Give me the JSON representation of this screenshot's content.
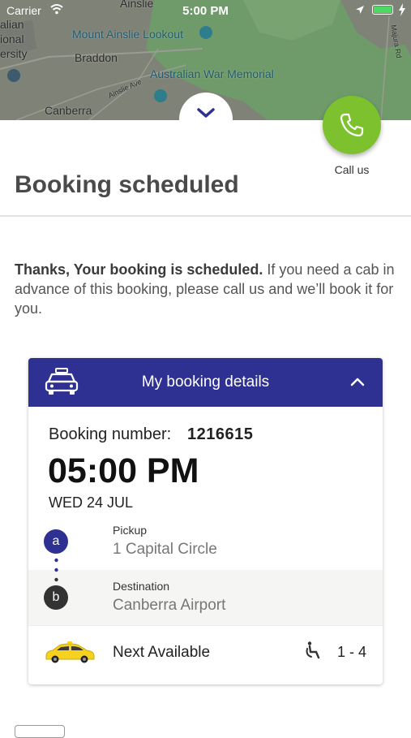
{
  "status_bar": {
    "carrier": "Carrier",
    "time": "5:00 PM"
  },
  "map": {
    "labels": {
      "ainslie": "Ainslie",
      "alian": "alian",
      "ional": "ional",
      "ersity": "ersity",
      "lookout": "Mount Ainslie Lookout",
      "braddon": "Braddon",
      "war_memorial": "Australian War Memorial",
      "ainslie_ave": "Ainslie Ave",
      "majura_rd": "Majura Rd",
      "canberra": "Canberra"
    }
  },
  "call": {
    "label": "Call us"
  },
  "page": {
    "title": "Booking scheduled",
    "message_bold": "Thanks, Your booking is scheduled.",
    "message_rest": " If you need a cab in advance of this booking, please call us and we’ll book it for you."
  },
  "booking_card": {
    "header_title": "My booking details",
    "booking_number_label": "Booking number:",
    "booking_number": "1216615",
    "time": "05:00 PM",
    "date": "WED 24 JUL",
    "pickup": {
      "marker": "a",
      "label": "Pickup",
      "address": "1 Capital Circle"
    },
    "destination": {
      "marker": "b",
      "label": "Destination",
      "address": "Canberra Airport"
    },
    "vehicle": "Next Available",
    "capacity": "1 - 4"
  },
  "colors": {
    "brand": "#2e3192",
    "call": "#7dc22e",
    "cab": "#f6d21e"
  },
  "icons": [
    "wifi-icon",
    "location-arrow-icon",
    "battery-icon",
    "charging-bolt-icon",
    "chevron-down-icon",
    "phone-icon",
    "taxi-icon",
    "chevron-up-icon",
    "cab-icon",
    "wheelchair-icon"
  ]
}
